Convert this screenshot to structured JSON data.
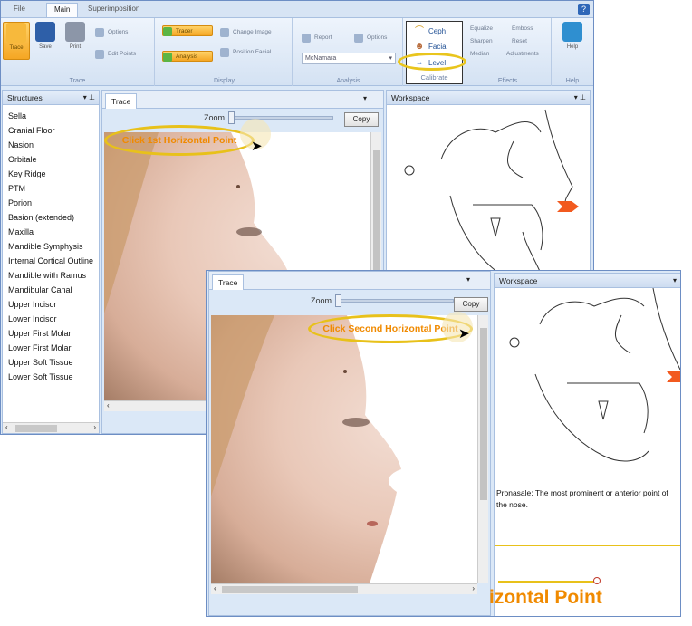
{
  "ribbon": {
    "tabs": [
      "File",
      "Main",
      "Superimposition"
    ],
    "active_tab": "Main",
    "help_icon": "?",
    "groups": {
      "trace": {
        "label": "Trace",
        "buttons": [
          "Trace",
          "Save",
          "Print"
        ],
        "small": [
          "Options",
          "Edit Points"
        ]
      },
      "display": {
        "label": "Display",
        "small": [
          "Tracer",
          "Analysis",
          "Change Image",
          "Position Facial"
        ]
      },
      "analysis": {
        "label": "Analysis",
        "small": [
          "Report",
          "Options"
        ],
        "select_value": "McNamara"
      },
      "effects": {
        "label": "Effects",
        "small": [
          "Equalize",
          "Sharpen",
          "Median",
          "Emboss",
          "Reset",
          "Adjustments"
        ]
      },
      "help": {
        "label": "Help",
        "button": "Help"
      }
    },
    "calibrate": {
      "label": "Calibrate",
      "items": [
        "Ceph",
        "Facial",
        "Level"
      ]
    }
  },
  "structures": {
    "title": "Structures",
    "items": [
      "Sella",
      "Cranial Floor",
      "Nasion",
      "Orbitale",
      "Key Ridge",
      "PTM",
      "Porion",
      "Basion (extended)",
      "Maxilla",
      "Mandible Symphysis",
      "Internal Cortical Outline",
      "Mandible with Ramus",
      "Mandibular Canal",
      "Upper Incisor",
      "Lower Incisor",
      "Upper First Molar",
      "Lower First Molar",
      "Upper Soft Tissue",
      "Lower Soft Tissue"
    ]
  },
  "trace": {
    "tab_label": "Trace",
    "zoom_label": "Zoom",
    "copy_label": "Copy",
    "callout1": "Click 1st Horizontal Point",
    "callout2": "Click Second Horizontal Point"
  },
  "workspace": {
    "title": "Workspace",
    "description": "Pronasale: The most prominent or anterior point of the nose.",
    "big_hint": "izontal Point"
  },
  "colors": {
    "callout_ring": "#e8c11a",
    "callout_text": "#f08a00",
    "marker": "#f25a1f",
    "ribbon_blue": "#2f67b8"
  }
}
